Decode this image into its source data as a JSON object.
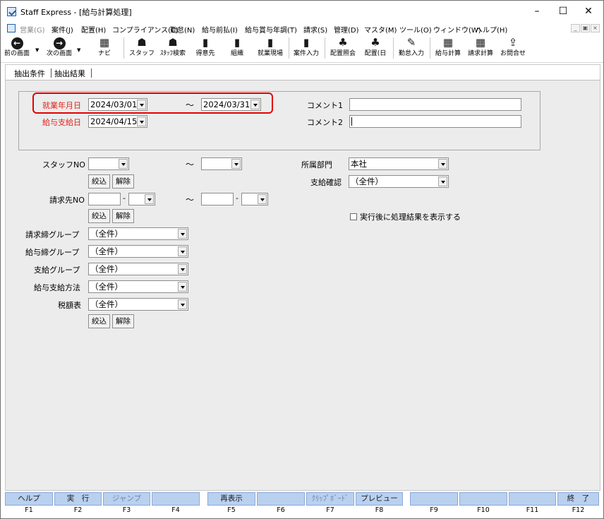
{
  "window": {
    "title": "Staff Express - [給与計算処理]"
  },
  "menu": [
    {
      "label": "営業(G)",
      "disabled": true
    },
    {
      "label": "案件(J)"
    },
    {
      "label": "配置(H)"
    },
    {
      "label": "コンプライアンス(C)"
    },
    {
      "label": "勤怠(N)"
    },
    {
      "label": "給与前払(I)"
    },
    {
      "label": "給与賞与年調(T)"
    },
    {
      "label": "請求(S)"
    },
    {
      "label": "管理(D)"
    },
    {
      "label": "マスタ(M)"
    },
    {
      "label": "ツール(O)"
    },
    {
      "label": "ウィンドウ(W)"
    },
    {
      "label": "ヘルプ(H)"
    }
  ],
  "toolbar": [
    {
      "label": "前の画面",
      "icon": "back-arrow-icon",
      "glyph": "←"
    },
    {
      "label": "次の画面",
      "icon": "forward-arrow-icon",
      "glyph": "→"
    },
    {
      "label": "ナビ",
      "icon": "navi-icon",
      "glyph": "▦"
    },
    {
      "label": "スタッフ",
      "icon": "staff-icon",
      "glyph": "☗"
    },
    {
      "label": "ｽﾀｯﾌ検索",
      "icon": "staff-search-icon",
      "glyph": "☗"
    },
    {
      "label": "得意先",
      "icon": "customer-icon",
      "glyph": "▮"
    },
    {
      "label": "組織",
      "icon": "organization-icon",
      "glyph": "▮"
    },
    {
      "label": "就業現場",
      "icon": "worksite-icon",
      "glyph": "▮"
    },
    {
      "label": "案件入力",
      "icon": "case-entry-icon",
      "glyph": "▮"
    },
    {
      "label": "配置照会",
      "icon": "placement-inquiry-icon",
      "glyph": "♣"
    },
    {
      "label": "配置(日",
      "icon": "placement-daily-icon",
      "glyph": "♣"
    },
    {
      "label": "勤怠入力",
      "icon": "attendance-entry-icon",
      "glyph": "✎"
    },
    {
      "label": "給与計算",
      "icon": "payroll-calc-icon",
      "glyph": "▦"
    },
    {
      "label": "請求計算",
      "icon": "billing-calc-icon",
      "glyph": "▦"
    },
    {
      "label": "お問合せ",
      "icon": "inquiry-icon",
      "glyph": "⇪"
    }
  ],
  "tabs": [
    "抽出条件",
    "抽出結果"
  ],
  "form": {
    "work_date_label": "就業年月日",
    "work_date_from": "2024/03/01",
    "work_date_to": "2024/03/31",
    "pay_date_label": "給与支給日",
    "pay_date": "2024/04/15",
    "comment1_label": "コメント1",
    "comment1_value": "",
    "comment2_label": "コメント2",
    "comment2_value": "",
    "staff_no_label": "スタッフNO",
    "staff_no_from": "",
    "staff_no_to": "",
    "billing_no_label": "請求先NO",
    "billing_no_from_a": "",
    "billing_no_from_b": "",
    "billing_no_to_a": "",
    "billing_no_to_b": "",
    "filter_label": "絞込",
    "clear_label": "解除",
    "tilde": "～",
    "dash": "-",
    "department_label": "所属部門",
    "department_value": "本社",
    "pay_confirm_label": "支給確認",
    "pay_confirm_value": "（全件）",
    "show_result_label": "実行後に処理結果を表示する",
    "show_result_checked": false,
    "billing_close_group_label": "請求締グループ",
    "billing_close_group_value": "（全件）",
    "pay_close_group_label": "給与締グループ",
    "pay_close_group_value": "（全件）",
    "payment_group_label": "支給グループ",
    "payment_group_value": "（全件）",
    "pay_method_label": "給与支給方法",
    "pay_method_value": "（全件）",
    "tax_table_label": "税額表",
    "tax_table_value": "（全件）"
  },
  "fkeys": [
    {
      "label": "ヘルプ",
      "key": "F1"
    },
    {
      "label": "実　行",
      "key": "F2"
    },
    {
      "label": "ジャンプ",
      "key": "F3",
      "disabled": true
    },
    {
      "label": "",
      "key": "F4"
    },
    {
      "label": "再表示",
      "key": "F5"
    },
    {
      "label": "",
      "key": "F6"
    },
    {
      "label": "ｸﾘｯﾌﾟﾎﾞｰﾄﾞ",
      "key": "F7",
      "disabled": true
    },
    {
      "label": "プレビュー",
      "key": "F8"
    },
    {
      "label": "",
      "key": "F9"
    },
    {
      "label": "",
      "key": "F10"
    },
    {
      "label": "",
      "key": "F11"
    },
    {
      "label": "終　了",
      "key": "F12"
    }
  ],
  "colors": {
    "highlight": "#e60000",
    "required_label": "#e0221a",
    "fkey_bg": "#b9d0ef"
  }
}
